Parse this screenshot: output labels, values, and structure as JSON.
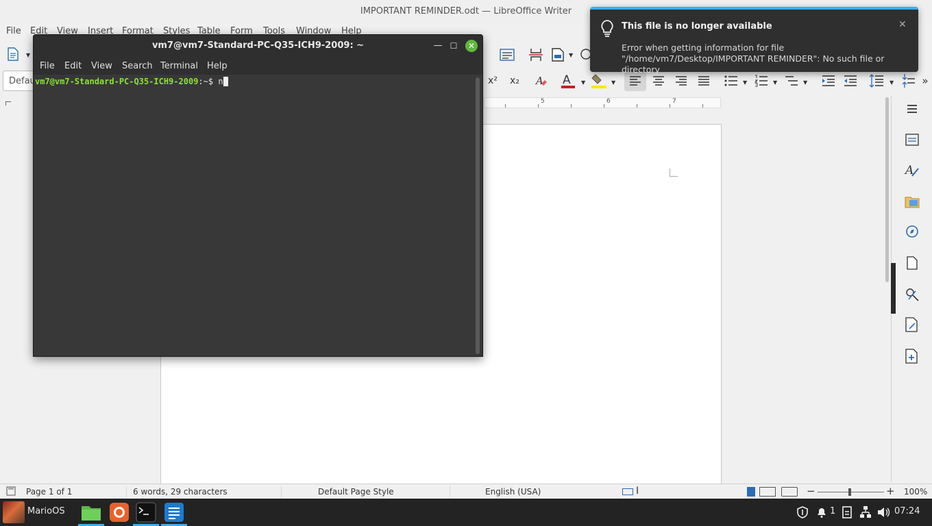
{
  "writer": {
    "window_title": "IMPORTANT REMINDER.odt — LibreOffice Writer",
    "menu": [
      "File",
      "Edit",
      "View",
      "Insert",
      "Format",
      "Styles",
      "Table",
      "Form",
      "Tools",
      "Window",
      "Help"
    ],
    "paragraph_style": "Defau",
    "ruler_numbers": [
      "5",
      "6",
      "7"
    ],
    "status": {
      "page": "Page 1 of 1",
      "words": "6 words, 29 characters",
      "page_style": "Default Page Style",
      "language": "English (USA)",
      "zoom": "100%"
    }
  },
  "terminal": {
    "title": "vm7@vm7-Standard-PC-Q35-ICH9-2009: ~",
    "menu": [
      "File",
      "Edit",
      "View",
      "Search",
      "Terminal",
      "Help"
    ],
    "prompt_user": "vm7@vm7-Standard-PC-Q35-ICH9-2009",
    "prompt_symbol": ":~$ ",
    "input": "n"
  },
  "notification": {
    "title": "This file is no longer available",
    "body": "Error when getting information for file \"/home/vm7/Desktop/IMPORTANT REMINDER\": No such file or directory"
  },
  "taskbar": {
    "start_label": "MarioOS",
    "tray_count": "1",
    "clock": "07:24"
  },
  "colors": {
    "accent": "#3daee9",
    "terminal_prompt": "#8ae234",
    "terminal_bg": "#383838",
    "close_button": "#5fb83e"
  }
}
